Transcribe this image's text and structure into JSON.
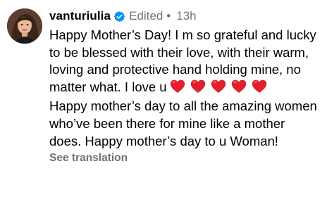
{
  "comment": {
    "username": "vanturiulia",
    "edited_label": "Edited",
    "separator": "•",
    "time": "13h",
    "paragraph_1": "Happy Mother’s Day! I m so grateful and lucky to be blessed with their love, with their warm, loving and protective hand holding mine, no matter what. I love u",
    "paragraph_2": "Happy mother’s day to all the amazing women who’ve been there for mine like a mother does. Happy mother’s day to u Woman!",
    "see_translation": "See translation",
    "heart_icon": "red-heart-emoji",
    "heart_count": 5
  },
  "colors": {
    "text": "#000000",
    "secondary": "#737373",
    "verified_badge": "#0095f6",
    "heart": "#e0202c"
  }
}
